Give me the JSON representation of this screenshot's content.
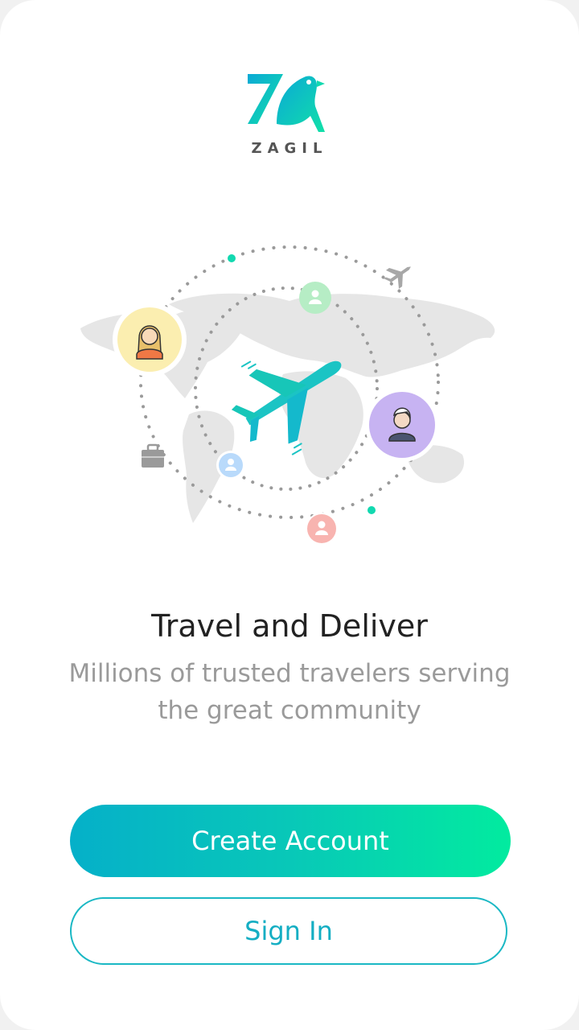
{
  "app": {
    "logo_text": "ZAGIL"
  },
  "onboarding": {
    "title": "Travel and Deliver",
    "subtitle_line1": "Millions of trusted travelers serving",
    "subtitle_line2": "the great community"
  },
  "actions": {
    "create_account_label": "Create Account",
    "sign_in_label": "Sign In"
  },
  "colors": {
    "accent": "#14aec3",
    "gradient_start": "#05b0c9",
    "gradient_end": "#02eb9f"
  },
  "icons": [
    "zagil-logo",
    "world-map",
    "airplane-icon",
    "user-icon",
    "briefcase-icon"
  ]
}
